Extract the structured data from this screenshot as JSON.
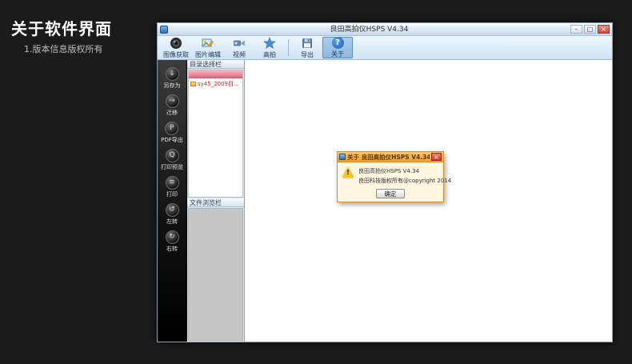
{
  "annotation": {
    "heading": "关于软件界面",
    "subheading": "1.版本信息版权所有"
  },
  "window": {
    "title": "良田高拍仪HSPS V4.34",
    "controls": {
      "minimize": "–",
      "maximize": "□",
      "close": "×"
    },
    "toolbar": {
      "items": [
        {
          "label": "图像获取",
          "icon": "camera-capture-icon"
        },
        {
          "label": "图片编辑",
          "icon": "image-edit-icon"
        },
        {
          "label": "视频",
          "icon": "video-icon"
        },
        {
          "label": "高拍",
          "icon": "star-shot-icon"
        },
        {
          "label": "导出",
          "icon": "export-icon"
        },
        {
          "label": "关于",
          "icon": "about-icon",
          "glyph": "?"
        }
      ]
    },
    "sidebar": {
      "items": [
        {
          "label": "另存为",
          "icon": "save-as-icon",
          "glyph": "↓"
        },
        {
          "label": "迁移",
          "icon": "migrate-icon",
          "glyph": "→"
        },
        {
          "label": "PDF导出",
          "icon": "pdf-export-icon",
          "glyph": "P"
        },
        {
          "label": "打印预览",
          "icon": "print-preview-icon",
          "glyph": "Q"
        },
        {
          "label": "打印",
          "icon": "print-icon",
          "glyph": "≡"
        },
        {
          "label": "左转",
          "icon": "rotate-left-icon",
          "glyph": "↺"
        },
        {
          "label": "右转",
          "icon": "rotate-right-icon",
          "glyph": "↻"
        }
      ]
    },
    "directory_panel": {
      "header": "目录选择栏",
      "item": "sy45_2009目..."
    },
    "file_panel": {
      "header": "文件浏览栏"
    }
  },
  "dialog": {
    "title": "关于 良田高拍仪HSPS V4.34",
    "close": "×",
    "warning_glyph": "!",
    "line1": "良田高拍仪HSPS V4.34",
    "line2": "良田科技版权所有@copyright 2014",
    "ok": "确定"
  },
  "colors": {
    "accent_blue": "#2a7ad2",
    "dialog_titlebar_orange": "#ef9c2e",
    "alert_red": "#cc3b2c",
    "tree_item_text_red": "#d42020"
  }
}
